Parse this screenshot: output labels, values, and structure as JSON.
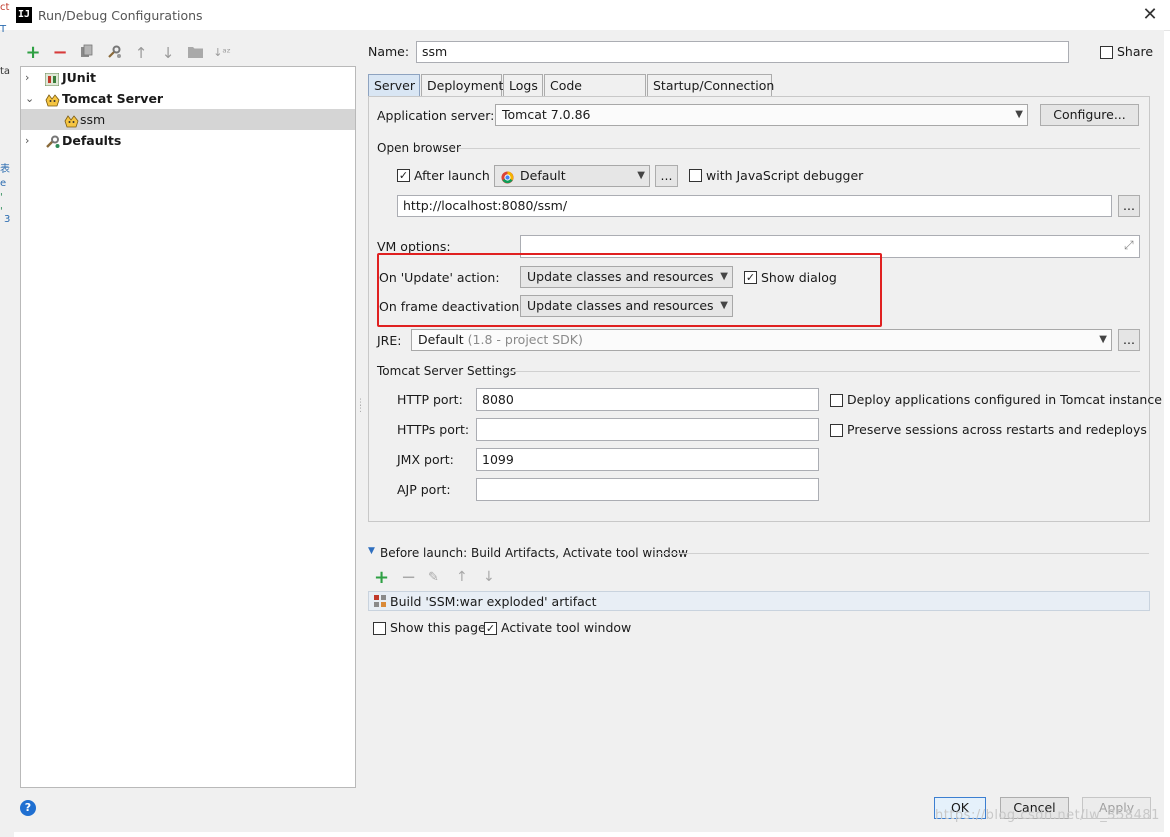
{
  "window": {
    "title": "Run/Debug Configurations",
    "app_icon_text": "IJ"
  },
  "left_edge_glyphs": [
    "ct",
    "T",
    "ta",
    "表",
    "e",
    "'",
    "'",
    "3"
  ],
  "tree": {
    "items": [
      {
        "label": "JUnit",
        "icon": "junit-icon"
      },
      {
        "label": "Tomcat Server",
        "icon": "tomcat-icon"
      },
      {
        "label": "ssm",
        "icon": "tomcat-icon"
      },
      {
        "label": "Defaults",
        "icon": "wrench-icon"
      }
    ]
  },
  "header": {
    "name_label": "Name:",
    "name_value": "ssm",
    "share_label": "Share"
  },
  "tabs": [
    "Server",
    "Deployment",
    "Logs",
    "Code Coverage",
    "Startup/Connection"
  ],
  "server": {
    "app_server_label": "Application server:",
    "app_server_value": "Tomcat 7.0.86",
    "configure_button": "Configure...",
    "open_browser_label": "Open browser",
    "after_launch_label": "After launch",
    "browser_value": "Default",
    "ellipsis": "...",
    "js_debugger_label": "with JavaScript debugger",
    "url_value": "http://localhost:8080/ssm/",
    "vm_options_label": "VM options:",
    "vm_options_value": "",
    "on_update_label": "On 'Update' action:",
    "on_update_value": "Update classes and resources",
    "show_dialog_label": "Show dialog",
    "on_frame_label": "On frame deactivation:",
    "on_frame_value": "Update classes and resources",
    "jre_label": "JRE:",
    "jre_value": "Default",
    "jre_hint": "(1.8 - project SDK)",
    "tomcat_settings_label": "Tomcat Server Settings",
    "http_port_label": "HTTP port:",
    "http_port_value": "8080",
    "https_port_label": "HTTPs port:",
    "https_port_value": "",
    "jmx_port_label": "JMX port:",
    "jmx_port_value": "1099",
    "ajp_port_label": "AJP port:",
    "ajp_port_value": "",
    "deploy_apps_label": "Deploy applications configured in Tomcat instance",
    "preserve_sessions_label": "Preserve sessions across restarts and redeploys"
  },
  "before_launch": {
    "header": "Before launch: Build Artifacts, Activate tool window",
    "artifact": "Build 'SSM:war exploded' artifact",
    "show_page_label": "Show this page",
    "activate_tool_label": "Activate tool window"
  },
  "buttons": {
    "ok": "OK",
    "cancel": "Cancel",
    "apply": "Apply"
  },
  "watermark": "https://blog.csdn.net/lw_358481"
}
